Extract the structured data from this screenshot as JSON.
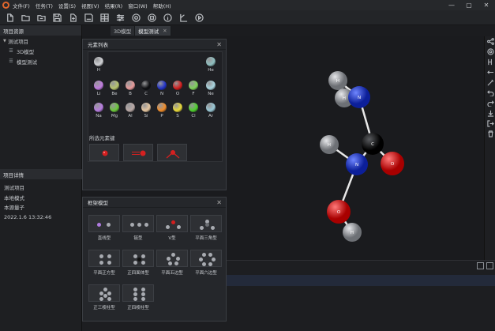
{
  "menubar": {
    "items": [
      "文件(F)",
      "任务(T)",
      "设置(S)",
      "视图(V)",
      "结果(R)",
      "窗口(W)",
      "帮助(H)"
    ],
    "window_controls": [
      "—",
      "▢",
      "✕"
    ]
  },
  "toolbar": {
    "icons": [
      "new-file-icon",
      "open-folder-icon",
      "open-recent-icon",
      "save-icon",
      "export-icon",
      "save-as-icon",
      "table-icon",
      "settings-sliders-icon",
      "record-icon",
      "stop-icon",
      "info-icon",
      "ruler-icon",
      "play-icon"
    ]
  },
  "left_panel": {
    "title": "项目资源",
    "tree": {
      "root": "测试项目",
      "children": [
        "3D模型",
        "模型测试"
      ]
    },
    "details_title": "项目详情",
    "details": [
      "测试项目",
      "本地模式",
      "本源量子",
      "2022.1.6 13:32:46"
    ]
  },
  "tabs": [
    {
      "label": "3D模型",
      "close": ""
    },
    {
      "label": "模型测试",
      "close": "✕"
    }
  ],
  "elements_panel": {
    "title": "元素列表",
    "close": "✕",
    "elements": [
      {
        "symbol": "H",
        "color": "#d0d2d6"
      },
      {
        "symbol": "He",
        "color": "#8fbfc0"
      },
      {
        "symbol": "Li",
        "color": "#c07be0"
      },
      {
        "symbol": "Be",
        "color": "#b7c46e"
      },
      {
        "symbol": "B",
        "color": "#e89b9b"
      },
      {
        "symbol": "C",
        "color": "#101114"
      },
      {
        "symbol": "N",
        "color": "#2233c8"
      },
      {
        "symbol": "O",
        "color": "#d31e1e"
      },
      {
        "symbol": "F",
        "color": "#7ed35a"
      },
      {
        "symbol": "Ne",
        "color": "#a9d5e0"
      },
      {
        "symbol": "Na",
        "color": "#b77ce0"
      },
      {
        "symbol": "Mg",
        "color": "#6cc83c"
      },
      {
        "symbol": "Al",
        "color": "#b9a9a6"
      },
      {
        "symbol": "Si",
        "color": "#e7c7a0"
      },
      {
        "symbol": "P",
        "color": "#f08c2a"
      },
      {
        "symbol": "S",
        "color": "#e8d93a"
      },
      {
        "symbol": "Cl",
        "color": "#4fd02e"
      },
      {
        "symbol": "Ar",
        "color": "#99c8d6"
      }
    ],
    "selected_bonds_label": "所选元素键"
  },
  "models_panel": {
    "title": "框架模型",
    "close": "✕",
    "models": [
      "直线型",
      "链型",
      "V型",
      "平面三角型",
      "平面正方型",
      "正四面体型",
      "平面五边型",
      "平面六边型",
      "正三棱柱型",
      "正四棱柱型"
    ]
  },
  "molecule": {
    "atoms": [
      {
        "label": "H",
        "color": "#9a9da2"
      },
      {
        "label": "H",
        "color": "#9a9da2"
      },
      {
        "label": "N",
        "color": "#1f3ad0"
      },
      {
        "label": "C",
        "color": "#0b0b0d"
      },
      {
        "label": "H",
        "color": "#9a9da2"
      },
      {
        "label": "N",
        "color": "#1f3ad0"
      },
      {
        "label": "O",
        "color": "#e01212"
      },
      {
        "label": "O",
        "color": "#e01212"
      },
      {
        "label": "H",
        "color": "#9a9da2"
      }
    ]
  },
  "colors": {
    "accent": "#e0662c",
    "panel_bg": "#25272b",
    "window_bg": "#1b1c1f"
  }
}
